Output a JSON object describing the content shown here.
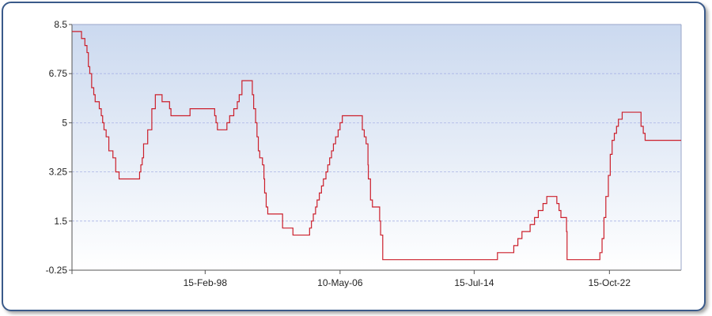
{
  "chart_data": {
    "type": "line",
    "step": true,
    "title": "",
    "xlabel": "",
    "ylabel": "",
    "ylim": [
      -0.25,
      8.5
    ],
    "xlim": [
      "1990-01-01",
      "2027-03-01"
    ],
    "y_ticks": [
      "8.5",
      "6.75",
      "5",
      "3.25",
      "1.5",
      "-0.25"
    ],
    "x_ticks": [
      "15-Feb-98",
      "10-May-06",
      "15-Jul-14",
      "15-Oct-22"
    ],
    "grid": true,
    "legend": "none",
    "colors": {
      "line": "#cc1f2b",
      "plot_top": "#cbd9ef",
      "plot_bottom": "#ffffff",
      "grid": "#a9b4e6",
      "frame": "#3a5a8a"
    },
    "series": [
      {
        "values": [
          [
            "1990-01-01",
            8.25
          ],
          [
            "1990-08-01",
            8.0
          ],
          [
            "1990-10-15",
            7.75
          ],
          [
            "1990-12-01",
            7.5
          ],
          [
            "1991-01-01",
            7.0
          ],
          [
            "1991-02-01",
            6.75
          ],
          [
            "1991-03-15",
            6.25
          ],
          [
            "1991-05-01",
            6.0
          ],
          [
            "1991-06-01",
            5.75
          ],
          [
            "1991-09-01",
            5.5
          ],
          [
            "1991-10-15",
            5.25
          ],
          [
            "1991-11-15",
            5.0
          ],
          [
            "1991-12-15",
            4.75
          ],
          [
            "1992-02-01",
            4.5
          ],
          [
            "1992-04-01",
            4.0
          ],
          [
            "1992-07-01",
            3.75
          ],
          [
            "1992-09-01",
            3.25
          ],
          [
            "1992-11-15",
            3.0
          ],
          [
            "1994-02-15",
            3.25
          ],
          [
            "1994-03-15",
            3.5
          ],
          [
            "1994-04-15",
            3.75
          ],
          [
            "1994-05-15",
            4.25
          ],
          [
            "1994-08-15",
            4.75
          ],
          [
            "1994-11-15",
            5.5
          ],
          [
            "1995-02-01",
            6.0
          ],
          [
            "1995-07-01",
            5.75
          ],
          [
            "1995-12-15",
            5.5
          ],
          [
            "1996-01-15",
            5.25
          ],
          [
            "1997-03-15",
            5.5
          ],
          [
            "1998-09-15",
            5.25
          ],
          [
            "1998-10-15",
            5.0
          ],
          [
            "1998-11-15",
            4.75
          ],
          [
            "1999-06-15",
            5.0
          ],
          [
            "1999-08-15",
            5.25
          ],
          [
            "1999-11-15",
            5.5
          ],
          [
            "2000-02-01",
            5.75
          ],
          [
            "2000-03-15",
            6.0
          ],
          [
            "2000-05-15",
            6.5
          ],
          [
            "2001-01-01",
            6.0
          ],
          [
            "2001-01-31",
            5.5
          ],
          [
            "2001-03-15",
            5.0
          ],
          [
            "2001-04-15",
            4.5
          ],
          [
            "2001-05-15",
            4.0
          ],
          [
            "2001-06-15",
            3.75
          ],
          [
            "2001-08-15",
            3.5
          ],
          [
            "2001-09-17",
            3.0
          ],
          [
            "2001-10-02",
            2.5
          ],
          [
            "2001-11-06",
            2.0
          ],
          [
            "2001-12-11",
            1.75
          ],
          [
            "2002-11-06",
            1.25
          ],
          [
            "2003-06-25",
            1.0
          ],
          [
            "2004-06-30",
            1.25
          ],
          [
            "2004-08-10",
            1.5
          ],
          [
            "2004-09-21",
            1.75
          ],
          [
            "2004-11-10",
            2.0
          ],
          [
            "2004-12-14",
            2.25
          ],
          [
            "2005-02-02",
            2.5
          ],
          [
            "2005-03-22",
            2.75
          ],
          [
            "2005-05-03",
            3.0
          ],
          [
            "2005-06-30",
            3.25
          ],
          [
            "2005-08-09",
            3.5
          ],
          [
            "2005-09-20",
            3.75
          ],
          [
            "2005-11-01",
            4.0
          ],
          [
            "2005-12-13",
            4.25
          ],
          [
            "2006-01-31",
            4.5
          ],
          [
            "2006-03-28",
            4.75
          ],
          [
            "2006-05-10",
            5.0
          ],
          [
            "2006-06-29",
            5.25
          ],
          [
            "2007-09-18",
            4.75
          ],
          [
            "2007-10-31",
            4.5
          ],
          [
            "2007-12-11",
            4.25
          ],
          [
            "2008-01-22",
            3.5
          ],
          [
            "2008-01-30",
            3.0
          ],
          [
            "2008-03-18",
            2.25
          ],
          [
            "2008-04-30",
            2.0
          ],
          [
            "2008-10-08",
            1.5
          ],
          [
            "2008-10-29",
            1.0
          ],
          [
            "2008-12-16",
            0.125
          ],
          [
            "2015-12-16",
            0.375
          ],
          [
            "2016-12-14",
            0.625
          ],
          [
            "2017-03-15",
            0.875
          ],
          [
            "2017-06-14",
            1.125
          ],
          [
            "2017-12-13",
            1.375
          ],
          [
            "2018-03-21",
            1.625
          ],
          [
            "2018-06-13",
            1.875
          ],
          [
            "2018-09-26",
            2.125
          ],
          [
            "2018-12-19",
            2.375
          ],
          [
            "2019-07-31",
            2.125
          ],
          [
            "2019-09-18",
            1.875
          ],
          [
            "2019-10-30",
            1.625
          ],
          [
            "2020-03-03",
            1.125
          ],
          [
            "2020-03-15",
            0.125
          ],
          [
            "2022-03-16",
            0.375
          ],
          [
            "2022-05-04",
            0.875
          ],
          [
            "2022-06-15",
            1.625
          ],
          [
            "2022-07-27",
            2.375
          ],
          [
            "2022-09-21",
            3.125
          ],
          [
            "2022-11-02",
            3.875
          ],
          [
            "2022-12-14",
            4.375
          ],
          [
            "2023-02-01",
            4.625
          ],
          [
            "2023-03-22",
            4.875
          ],
          [
            "2023-05-03",
            5.125
          ],
          [
            "2023-07-26",
            5.375
          ],
          [
            "2024-09-18",
            4.875
          ],
          [
            "2024-11-07",
            4.625
          ],
          [
            "2024-12-18",
            4.375
          ],
          [
            "2027-03-01",
            4.375
          ]
        ]
      }
    ]
  }
}
